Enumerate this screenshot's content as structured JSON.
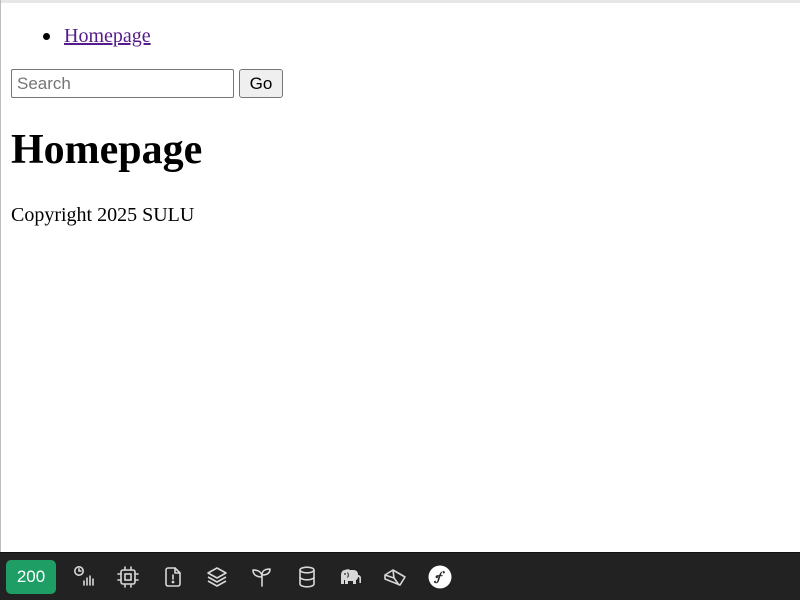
{
  "nav": {
    "items": [
      {
        "label": "Homepage"
      }
    ]
  },
  "search": {
    "placeholder": "Search",
    "value": "",
    "button_label": "Go"
  },
  "main": {
    "title": "Homepage",
    "copyright": "Copyright 2025 SULU"
  },
  "debug_toolbar": {
    "status_code": "200",
    "status_color": "#1e9e65",
    "background": "#222222",
    "icons": [
      "request-timer-icon",
      "memory-chip-icon",
      "logs-warning-icon",
      "cache-layers-icon",
      "events-sprout-icon",
      "database-icon",
      "php-elephant-icon",
      "mailer-icon",
      "symfony-logo-icon"
    ]
  }
}
